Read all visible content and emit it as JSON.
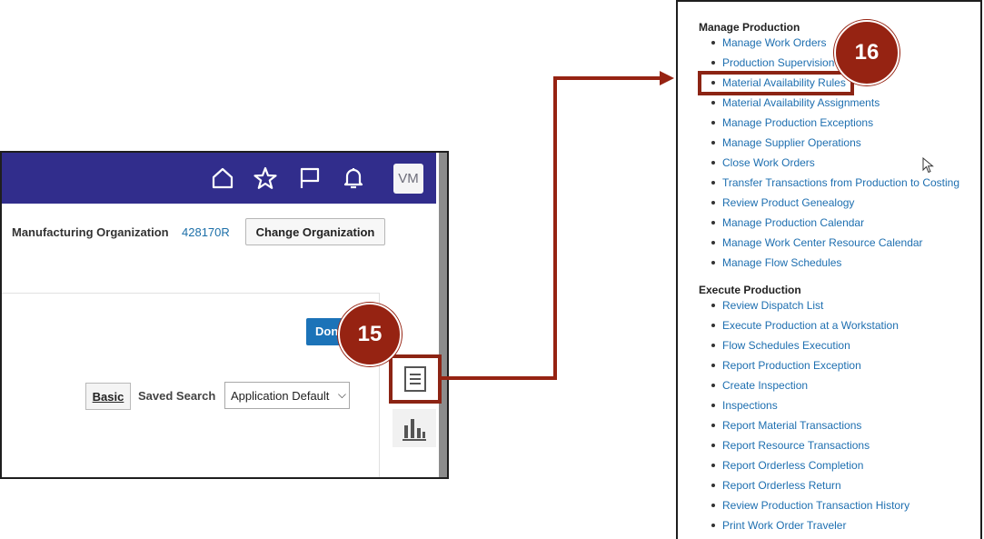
{
  "left_panel": {
    "header": {
      "background": "#312d8c",
      "icons": [
        "home-icon",
        "favorites-star-icon",
        "flag-icon",
        "notifications-bell-icon"
      ],
      "avatar_initials": "VM"
    },
    "org": {
      "label": "Manufacturing Organization",
      "code": "428170R",
      "change_button": "Change Organization"
    },
    "done_button_visible": "Don",
    "search": {
      "basic_button": "Basic",
      "saved_search_label": "Saved Search",
      "saved_search_value": "Application Default"
    },
    "side_icons": [
      "tasks-icon",
      "analytics-icon"
    ]
  },
  "badges": {
    "step_15": "15",
    "step_16": "16"
  },
  "accent_color": "#962312",
  "right_panel": {
    "sections": [
      {
        "title": "Manage Production",
        "items": [
          "Manage Work Orders",
          "Production Supervision",
          "Material Availability Rules",
          "Material Availability Assignments",
          "Manage Production Exceptions",
          "Manage Supplier Operations",
          "Close Work Orders",
          "Transfer Transactions from Production to Costing",
          "Review Product Genealogy",
          "Manage Production Calendar",
          "Manage Work Center Resource Calendar",
          "Manage Flow Schedules"
        ]
      },
      {
        "title": "Execute Production",
        "items": [
          "Review Dispatch List",
          "Execute Production at a Workstation",
          "Flow Schedules Execution",
          "Report Production Exception",
          "Create Inspection",
          "Inspections",
          "Report Material Transactions",
          "Report Resource Transactions",
          "Report Orderless Completion",
          "Report Orderless Return",
          "Review Production Transaction History",
          "Print Work Order Traveler"
        ]
      }
    ],
    "highlighted_item": "Material Availability Rules"
  }
}
